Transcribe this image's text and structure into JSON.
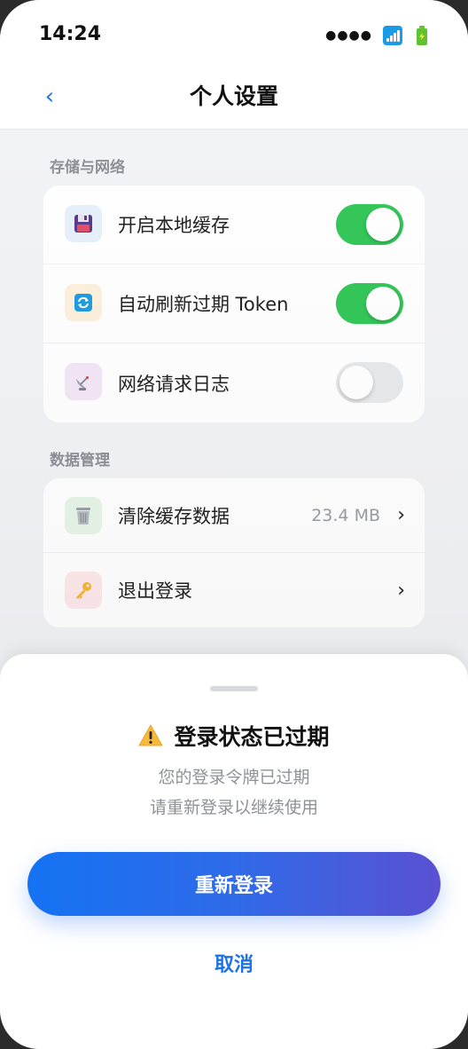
{
  "status_bar": {
    "time": "14:24",
    "signal_dots": "●●●●",
    "icons": [
      "signal-icon",
      "battery-charging-icon"
    ]
  },
  "header": {
    "back_glyph": "‹",
    "title": "个人设置"
  },
  "storage_section": {
    "title": "存储与网络",
    "items": [
      {
        "label": "开启本地缓存",
        "icon": "floppy-disk-icon",
        "toggle_on": true
      },
      {
        "label": "自动刷新过期 Token",
        "icon": "refresh-icon",
        "toggle_on": true
      },
      {
        "label": "网络请求日志",
        "icon": "satellite-dish-icon",
        "toggle_on": false
      }
    ]
  },
  "data_section": {
    "title": "数据管理",
    "items": [
      {
        "label": "清除缓存数据",
        "icon": "trash-can-icon",
        "value": "23.4 MB",
        "chevron": "›"
      },
      {
        "label": "退出登录",
        "icon": "key-icon",
        "chevron": "›"
      }
    ]
  },
  "sheet": {
    "title": "登录状态已过期",
    "icon": "warning-icon",
    "message_line1": "您的登录令牌已过期",
    "message_line2": "请重新登录以继续使用",
    "primary_label": "重新登录",
    "cancel_label": "取消"
  },
  "colors": {
    "accent": "#1a73e8",
    "toggle_on": "#34c759",
    "toggle_off": "#e8e9eb",
    "gradient_start": "#1473f4",
    "gradient_end": "#5a51d2",
    "background": "#f2f3f6"
  }
}
